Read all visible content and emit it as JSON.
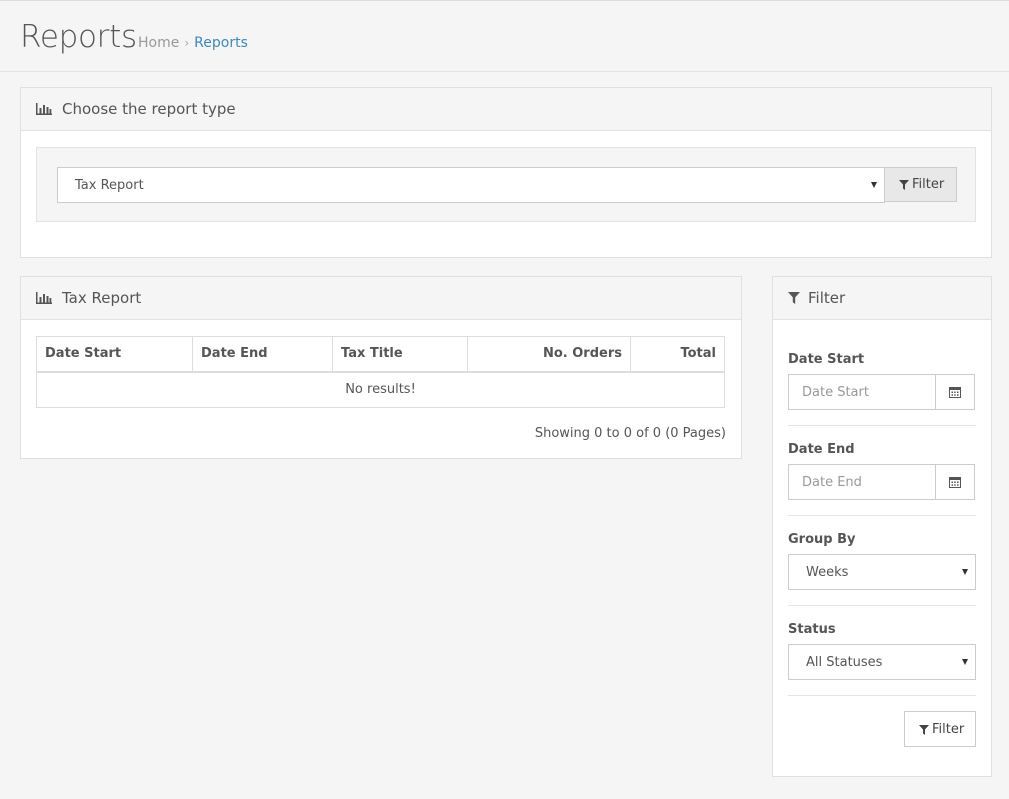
{
  "header": {
    "title": "Reports",
    "breadcrumb": {
      "home": "Home",
      "separator": "›",
      "current": "Reports"
    }
  },
  "report_type_panel": {
    "title": "Choose the report type",
    "title_icon": "bar-chart-icon",
    "select_value": "Tax Report",
    "filter_button": "Filter"
  },
  "report_panel": {
    "title": "Tax Report",
    "title_icon": "bar-chart-icon",
    "columns": [
      "Date Start",
      "Date End",
      "Tax Title",
      "No. Orders",
      "Total"
    ],
    "empty_message": "No results!",
    "pagination_text": "Showing 0 to 0 of 0 (0 Pages)"
  },
  "filter_panel": {
    "title": "Filter",
    "title_icon": "filter-icon",
    "date_start": {
      "label": "Date Start",
      "placeholder": "Date Start",
      "icon": "calendar-icon"
    },
    "date_end": {
      "label": "Date End",
      "placeholder": "Date End",
      "icon": "calendar-icon"
    },
    "group_by": {
      "label": "Group By",
      "value": "Weeks"
    },
    "status": {
      "label": "Status",
      "value": "All Statuses"
    },
    "filter_button": "Filter"
  },
  "colors": {
    "link": "#3a89c1",
    "background": "#f5f5f5",
    "border": "#dddddd"
  }
}
